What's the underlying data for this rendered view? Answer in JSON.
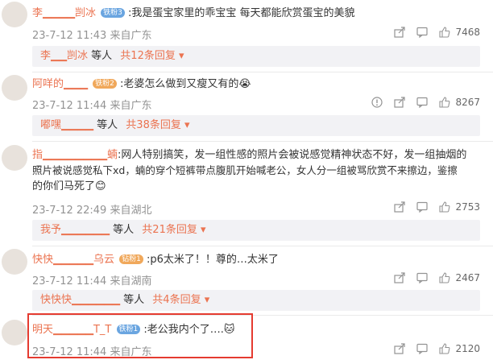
{
  "comments": [
    {
      "username": "李▁▁▁▁剀冰",
      "badge": "铁粉3",
      "badge_color": "#6aa5e0",
      "text": "我是蛋宝家里的乖宝宝 每天都能欣赏蛋宝的美貌",
      "emoji": "",
      "time": "23-7-12 11:43 来自广东",
      "likes": "7468",
      "reply": {
        "names": "李▁▁剀冰",
        "suffix": "等人",
        "more": "共12条回复 ▾"
      }
    },
    {
      "username": "阿咩的▁▁▁",
      "badge": "铁粉2",
      "badge_color": "#f0a85b",
      "text": "老婆怎么做到又瘦又有的",
      "emoji": "😭",
      "time": "23-7-12 11:44 来自广东",
      "likes": "8267",
      "reply": {
        "names": "嘟嘿▁▁▁▁",
        "suffix": "等人",
        "more": "共38条回复 ▾"
      }
    },
    {
      "username": "指▁▁▁▁▁▁▁▁蝻",
      "badge": "",
      "badge_color": "",
      "text_lines": [
        "网人特别搞笑，发一组性感的照片会被说感觉精神状态不好，发一组抽烟的",
        "照片被说感觉私下xd，蝻的穿个短裤带点腹肌开始喊老公，女人分一组被骂欣赏不来擦边，鉴擦",
        "的你们马死了"
      ],
      "emoji": "😊",
      "time": "23-7-12 22:49 来自湖北",
      "likes": "2753",
      "reply": {
        "names": "我予▁▁▁▁▁▁",
        "suffix": "等人",
        "more": "共21条回复 ▾"
      }
    },
    {
      "username": "快快▁▁▁▁▁乌云",
      "badge": "钻粉1",
      "badge_color": "#f0a85b",
      "text": "p6太米了！！尊的…太米了",
      "emoji": "",
      "time": "23-7-12 11:44 来自湖南",
      "likes": "2467",
      "reply": {
        "names": "快快快▁▁▁▁▁▁",
        "suffix": "等人",
        "more": "共4条回复 ▾"
      }
    },
    {
      "username": "明天▁▁▁▁▁T_T",
      "badge": "铁粉1",
      "badge_color": "#6aa5e0",
      "text": "老公我内个了….",
      "emoji": "🐱",
      "time": "23-7-12 11:44 来自广东",
      "likes": "2120"
    }
  ],
  "icons": {
    "share": "share-icon",
    "comment": "comment-icon",
    "like": "like-icon",
    "report": "report-icon"
  },
  "colors": {
    "username": "#eb7350",
    "meta": "#939393",
    "highlight": "#e53b30"
  }
}
